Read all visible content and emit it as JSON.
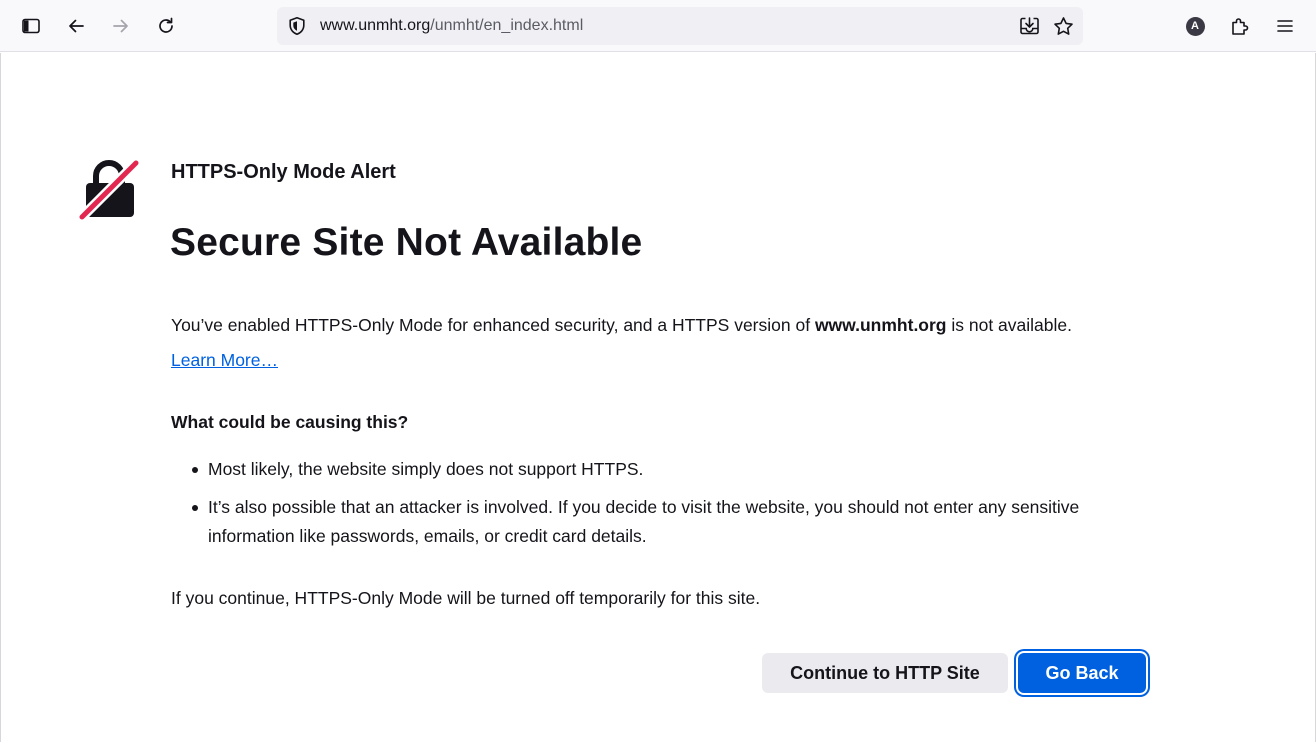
{
  "toolbar": {
    "url_host": "www.unmht.org",
    "url_path": "/unmht/en_index.html",
    "profile_initial": "A",
    "icons": {
      "sidebar": "sidebar-icon",
      "back": "back-arrow-icon",
      "forward": "forward-arrow-icon",
      "reload": "reload-icon",
      "shield": "shield-icon",
      "save_page": "save-to-pocket-icon",
      "bookmark": "star-icon",
      "extensions": "puzzle-piece-icon",
      "menu": "hamburger-menu-icon"
    }
  },
  "alert": {
    "label": "HTTPS-Only Mode Alert",
    "title": "Secure Site Not Available",
    "intro_before": "You’ve enabled HTTPS-Only Mode for enhanced security, and a HTTPS version of ",
    "intro_host": "www.unmht.org",
    "intro_after": " is not available.",
    "learn_more": "Learn More…",
    "cause_heading": "What could be causing this?",
    "causes": [
      "Most likely, the website simply does not support HTTPS.",
      "It’s also possible that an attacker is involved. If you decide to visit the website, you should not enter any sensitive information like passwords, emails, or credit card details."
    ],
    "continue_note": "If you continue, HTTPS-Only Mode will be turned off temporarily for this site.",
    "buttons": {
      "continue": "Continue to HTTP Site",
      "go_back": "Go Back"
    }
  },
  "colors": {
    "accent": "#0061e0",
    "text": "#15141a",
    "slash": "#e22850"
  }
}
